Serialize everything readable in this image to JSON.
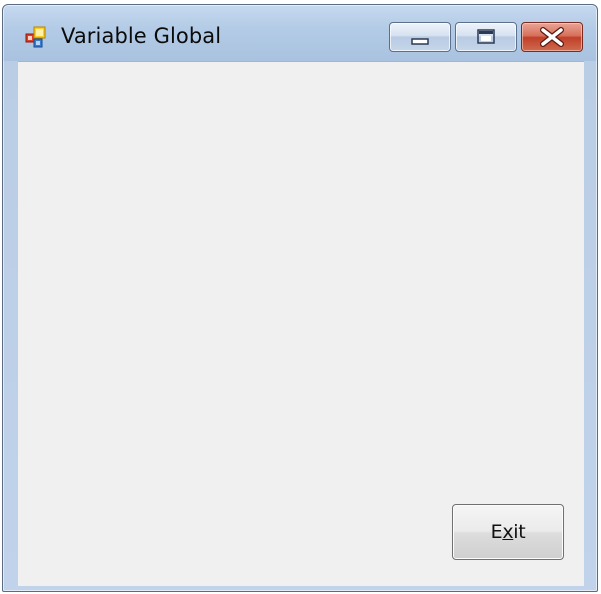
{
  "window": {
    "title": "Variable Global",
    "icon": "winforms-app-icon",
    "controls": {
      "minimize_icon": "minimize-icon",
      "maximize_icon": "maximize-icon",
      "close_icon": "close-icon"
    }
  },
  "form": {
    "exit_button": {
      "label_pre": "E",
      "label_mnemonic": "x",
      "label_post": "it"
    }
  },
  "colors": {
    "client_background": "#f0f0f0",
    "titlebar": "#b3cbe6",
    "close_button": "#c0402a"
  }
}
